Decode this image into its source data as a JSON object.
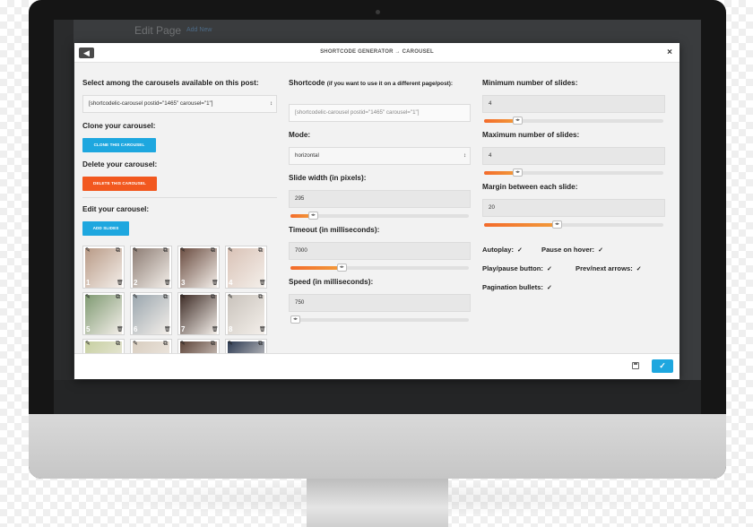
{
  "background_page": {
    "title": "Edit Page",
    "add_new": "Add New"
  },
  "modal": {
    "title": "SHORTCODE GENERATOR → CAROUSEL",
    "back_icon": "arrow-left-icon",
    "close_label": "×",
    "select_carousel": {
      "label": "Select among the carousels available on this post:",
      "value": "[shortcodelic-carousel postid=\"1465\" carousel=\"1\"]"
    },
    "clone": {
      "label": "Clone your carousel:",
      "button": "CLONE THIS CAROUSEL"
    },
    "delete": {
      "label": "Delete your carousel:",
      "button": "DELETE THIS CAROUSEL"
    },
    "edit": {
      "label": "Edit your carousel:",
      "button": "ADD SLIDES"
    },
    "slides": [
      {
        "num": "1"
      },
      {
        "num": "2"
      },
      {
        "num": "3"
      },
      {
        "num": "4"
      },
      {
        "num": "5"
      },
      {
        "num": "6"
      },
      {
        "num": "7"
      },
      {
        "num": "8"
      },
      {
        "num": ""
      },
      {
        "num": ""
      },
      {
        "num": ""
      },
      {
        "num": ""
      }
    ],
    "shortcode": {
      "label": "Shortcode",
      "hint": "(if you want to use it on a different page/post):",
      "value": "[shortcodelic-carousel postid=\"1465\" carousel=\"1\"]"
    },
    "mode": {
      "label": "Mode:",
      "value": "horizontal"
    },
    "slide_width": {
      "label": "Slide width (in pixels):",
      "value": "295",
      "level": 0.12
    },
    "timeout": {
      "label": "Timeout (in milliseconds):",
      "value": "7000",
      "level": 0.28
    },
    "speed": {
      "label": "Speed (in milliseconds):",
      "value": "750",
      "level": 0.02
    },
    "min_slides": {
      "label": "Minimum number of slides:",
      "value": "4",
      "level": 0.18
    },
    "max_slides": {
      "label": "Maximum number of slides:",
      "value": "4",
      "level": 0.18
    },
    "margin": {
      "label": "Margin between each slide:",
      "value": "20",
      "level": 0.4
    },
    "options": {
      "autoplay": "Autoplay:",
      "pause_on_hover": "Pause on hover:",
      "play_pause": "Play/pause button:",
      "prev_next": "Prev/next arrows:",
      "pagination": "Pagination bullets:"
    },
    "check_mark": "✓"
  },
  "colors": {
    "accent_blue": "#1ea7df",
    "accent_orange": "#f2581f"
  }
}
